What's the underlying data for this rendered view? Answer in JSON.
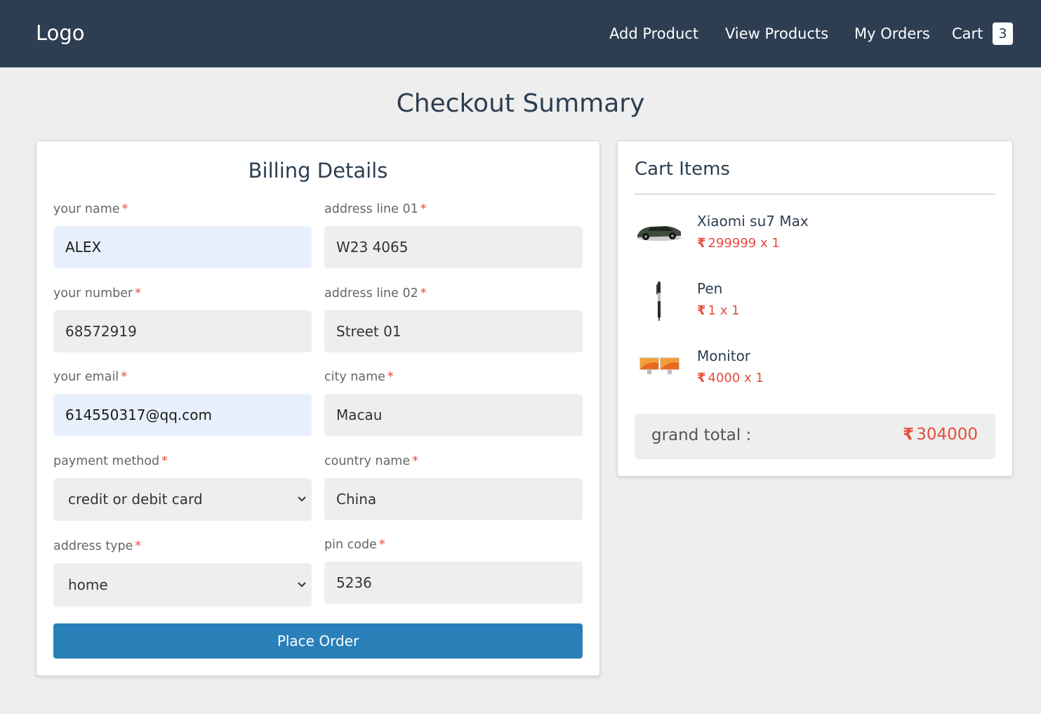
{
  "nav": {
    "logo": "Logo",
    "links": [
      "Add Product",
      "View Products",
      "My Orders",
      "Cart"
    ],
    "cart_count": "3"
  },
  "page_title": "Checkout Summary",
  "billing": {
    "title": "Billing Details",
    "fields": {
      "name": {
        "label": "your name",
        "value": "ALEX"
      },
      "address1": {
        "label": "address line 01",
        "value": "W23 4065"
      },
      "number": {
        "label": "your number",
        "value": "68572919"
      },
      "address2": {
        "label": "address line 02",
        "value": "Street 01"
      },
      "email": {
        "label": "your email",
        "value": "614550317@qq.com"
      },
      "city": {
        "label": "city name",
        "value": "Macau"
      },
      "payment": {
        "label": "payment method",
        "value": "credit or debit card"
      },
      "country": {
        "label": "country name",
        "value": "China"
      },
      "address_type": {
        "label": "address type",
        "value": "home"
      },
      "pin": {
        "label": "pin code",
        "value": "5236"
      }
    },
    "required_mark": "*",
    "place_order": "Place Order"
  },
  "cart": {
    "title": "Cart Items",
    "currency": "₹",
    "items": [
      {
        "name": "Xiaomi su7 Max",
        "price": "299999 x 1",
        "icon": "car-image"
      },
      {
        "name": "Pen",
        "price": "1 x 1",
        "icon": "pen-image"
      },
      {
        "name": "Monitor",
        "price": "4000 x 1",
        "icon": "monitor-image"
      }
    ],
    "grand_total_label": "grand total :",
    "grand_total_value": "304000"
  },
  "colors": {
    "navbar": "#2e3e52",
    "accent_button": "#2980b9",
    "price_red": "#e74c3c",
    "page_bg": "#eeeeee"
  }
}
